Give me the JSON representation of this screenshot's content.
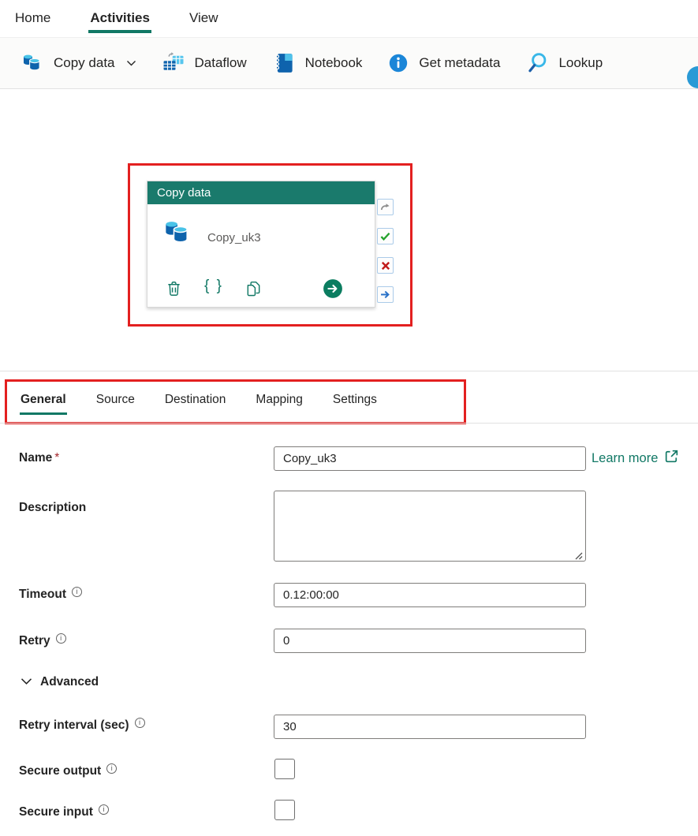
{
  "glyphs": {
    "info": "i",
    "braces": "{ }",
    "required_marker": "*"
  },
  "colors": {
    "accent_teal": "#117865",
    "card_header_teal": "#1a7a6c",
    "annotation_red": "#e32020",
    "link_teal": "#117865",
    "success_green": "#24a22c",
    "fail_red": "#c11c1c",
    "completion_blue": "#2a72c8",
    "skip_gray": "#8c8c8c"
  },
  "menubar": {
    "items": [
      {
        "label": "Home"
      },
      {
        "label": "Activities"
      },
      {
        "label": "View"
      }
    ],
    "active": "Activities"
  },
  "toolbar": {
    "items": [
      {
        "label": "Copy data",
        "icon": "copy-data-icon",
        "has_dropdown": true
      },
      {
        "label": "Dataflow",
        "icon": "dataflow-icon"
      },
      {
        "label": "Notebook",
        "icon": "notebook-icon"
      },
      {
        "label": "Get metadata",
        "icon": "get-metadata-icon"
      },
      {
        "label": "Lookup",
        "icon": "lookup-icon"
      }
    ]
  },
  "canvas": {
    "card": {
      "title": "Copy data",
      "activity_name": "Copy_uk3",
      "actions": [
        "delete",
        "expression-braces",
        "duplicate",
        "go"
      ],
      "connectors": [
        "on-skip",
        "on-success",
        "on-fail",
        "on-completion"
      ]
    }
  },
  "tabs": {
    "items": [
      {
        "label": "General"
      },
      {
        "label": "Source"
      },
      {
        "label": "Destination"
      },
      {
        "label": "Mapping"
      },
      {
        "label": "Settings"
      }
    ],
    "active": "General"
  },
  "form": {
    "name": {
      "label": "Name",
      "required": true,
      "value": "Copy_uk3"
    },
    "learn_more": {
      "label": "Learn more"
    },
    "description": {
      "label": "Description",
      "value": ""
    },
    "timeout": {
      "label": "Timeout",
      "value": "0.12:00:00",
      "has_info": true
    },
    "retry": {
      "label": "Retry",
      "value": "0",
      "has_info": true
    },
    "advanced": {
      "label": "Advanced",
      "expanded": true
    },
    "retry_interval": {
      "label": "Retry interval (sec)",
      "value": "30",
      "has_info": true
    },
    "secure_output": {
      "label": "Secure output",
      "checked": false,
      "has_info": true
    },
    "secure_input": {
      "label": "Secure input",
      "checked": false,
      "has_info": true
    }
  }
}
